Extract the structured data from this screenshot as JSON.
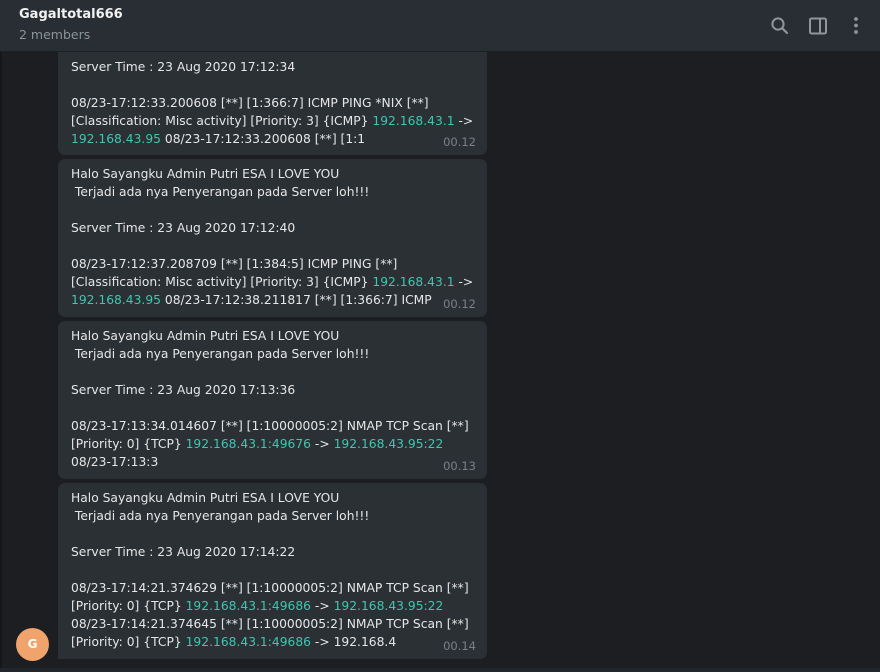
{
  "header": {
    "title": "Gagaltotal666",
    "subtitle": "2 members",
    "icons": [
      "search-icon",
      "side-panel-icon",
      "more-vertical-icon"
    ]
  },
  "avatar": {
    "letter": "G",
    "color": "#f0a36a"
  },
  "messages": [
    {
      "server_time": "Server Time : 23 Aug 2020 17:12:34",
      "l1a": "08/23-17:12:33.200608 [**] [1:366:7] ICMP PING *NIX [**]",
      "l2a": "[Classification: Misc activity] [Priority: 3] {ICMP} ",
      "l2link": "192.168.43.1",
      "l2b": " ->",
      "l3link": "192.168.43.95",
      "l3b": " 08/23-17:12:33.200608 [**] [1:1",
      "time": "00.12"
    },
    {
      "greeting": "Halo Sayangku Admin Putri ESA I LOVE YOU",
      "alert": " Terjadi ada nya Penyerangan pada Server loh!!!",
      "server_time": "Server Time : 23 Aug 2020 17:12:40",
      "l1a": "08/23-17:12:37.208709 [**] [1:384:5] ICMP PING [**]",
      "l2a": "[Classification: Misc activity] [Priority: 3] {ICMP} ",
      "l2link": "192.168.43.1",
      "l2b": " ->",
      "l3link": "192.168.43.95",
      "l3b": " 08/23-17:12:38.211817 [**] [1:366:7] ICMP",
      "time": "00.12"
    },
    {
      "greeting": "Halo Sayangku Admin Putri ESA I LOVE YOU",
      "alert": " Terjadi ada nya Penyerangan pada Server loh!!!",
      "server_time": "Server Time : 23 Aug 2020 17:13:36",
      "l1a": "08/23-17:13:34.014607 [**] [1:10000005:2] NMAP TCP Scan [**]",
      "l2a": "[Priority: 0] {TCP} ",
      "l2link": "192.168.43.1:49676",
      "l2b": " -> ",
      "l2link2": "192.168.43.95:22",
      "l3a": "08/23-17:13:3",
      "time": "00.13"
    },
    {
      "greeting": "Halo Sayangku Admin Putri ESA I LOVE YOU",
      "alert": " Terjadi ada nya Penyerangan pada Server loh!!!",
      "server_time": "Server Time : 23 Aug 2020 17:14:22",
      "l1a": "08/23-17:14:21.374629 [**] [1:10000005:2] NMAP TCP Scan [**]",
      "l2a": "[Priority: 0] {TCP} ",
      "l2link": "192.168.43.1:49686",
      "l2b": " -> ",
      "l2link2": "192.168.43.95:22",
      "l3a": "08/23-17:14:21.374645 [**] [1:10000005:2] NMAP TCP Scan [**]",
      "l4a": "[Priority: 0] {TCP} ",
      "l4link": "192.168.43.1:49686",
      "l4b": " -> 192.168.4",
      "time": "00.14"
    }
  ],
  "colors": {
    "bubble": "#2b3035",
    "link": "#3dc7b0",
    "header": "#282e33",
    "background": "#1c1e21"
  }
}
